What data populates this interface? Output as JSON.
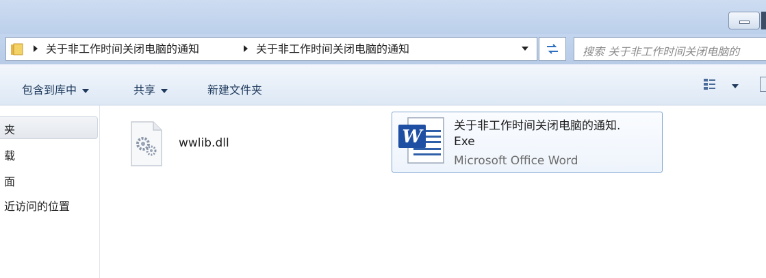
{
  "address": {
    "crumbs": [
      "关于非工作时间关闭电脑的通知",
      "关于非工作时间关闭电脑的通知"
    ]
  },
  "search": {
    "placeholder": "搜索 关于非工作时间关闭电脑的"
  },
  "toolbar": {
    "include_library": "包含到库中",
    "share": "共享",
    "new_folder": "新建文件夹"
  },
  "nav": {
    "items": [
      "夹",
      "载",
      "面",
      "近访问的位置"
    ]
  },
  "files": [
    {
      "name": "wwlib.dll",
      "type": "dll"
    },
    {
      "name_line1": "关于非工作时间关闭电脑的通知.",
      "name_line2": "Exe",
      "subtitle": "Microsoft Office Word",
      "type": "word"
    }
  ],
  "colors": {
    "accent": "#7da2ce",
    "titlebar": "#c6d7ef"
  }
}
